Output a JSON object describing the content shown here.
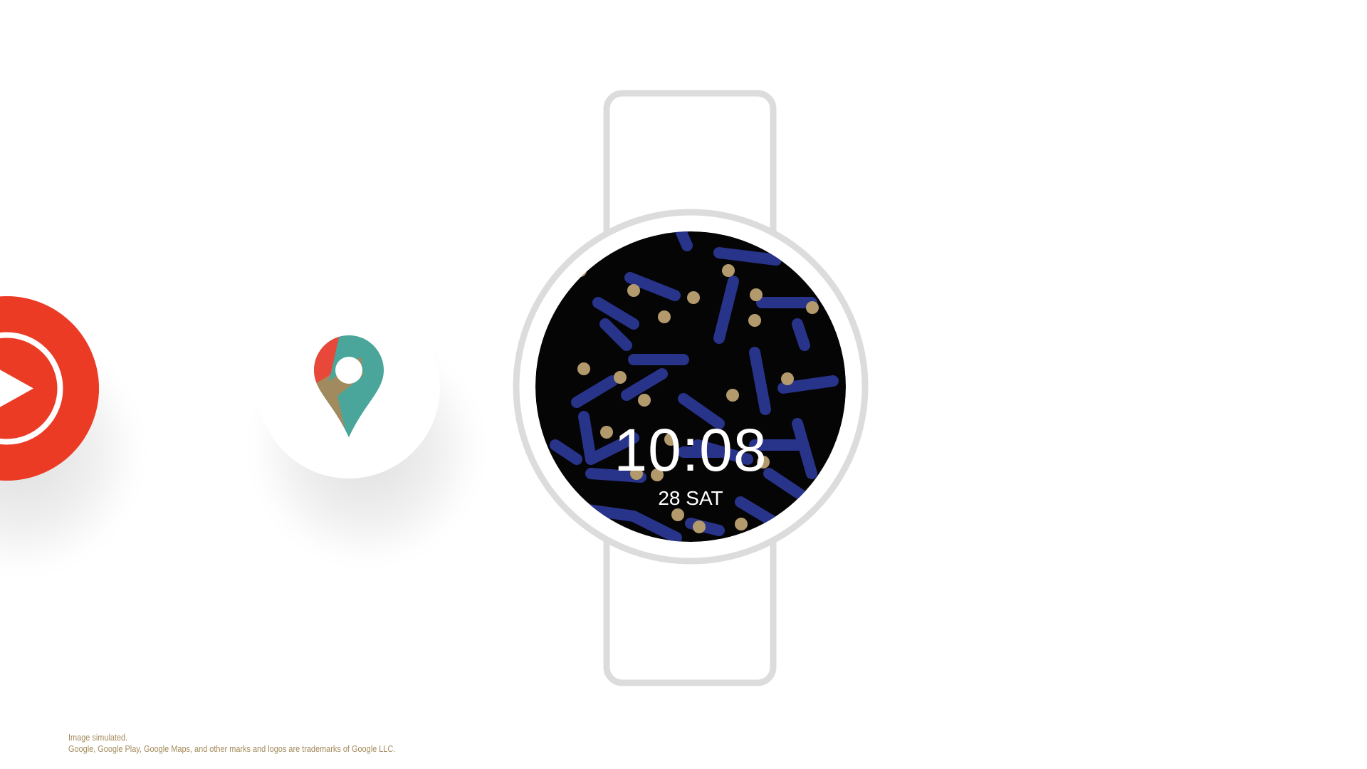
{
  "apps": [
    {
      "name": "YouTube Music",
      "icon": "youtube-music-icon",
      "color": "#ec3b25"
    },
    {
      "name": "Google Maps",
      "icon": "google-maps-pin-icon",
      "colors": [
        "#4aa59b",
        "#e8483a",
        "#a08a5e"
      ]
    }
  ],
  "watch": {
    "time": "10:08",
    "date": "28 SAT",
    "face_colors": {
      "background": "#050505",
      "stripes": "#28338a",
      "dots": "#b39a6c"
    },
    "frame_color": "#dcdcdc"
  },
  "disclaimer": {
    "line1": "Image simulated.",
    "line2": "Google, Google Play, Google Maps, and other marks and logos are trademarks of Google LLC."
  }
}
